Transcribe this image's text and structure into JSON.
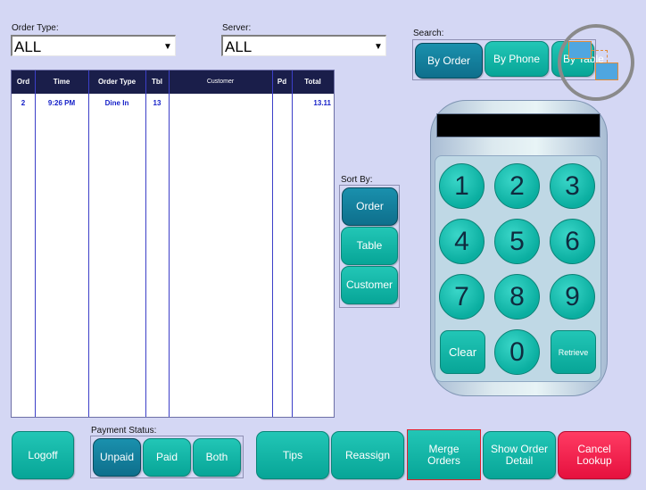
{
  "filters": {
    "order_type_label": "Order Type:",
    "order_type_value": "ALL",
    "server_label": "Server:",
    "server_value": "ALL"
  },
  "search": {
    "label": "Search:",
    "by_order": "By Order",
    "by_phone": "By Phone",
    "by_table": "By Table"
  },
  "table": {
    "columns": [
      "Ord",
      "Time",
      "Order Type",
      "Tbl",
      "Customer",
      "Pd",
      "Total"
    ],
    "rows": [
      {
        "ord": "2",
        "time": "9:26 PM",
        "order_type": "Dine In",
        "tbl": "13",
        "customer": "",
        "pd": "",
        "total": "13.11"
      }
    ]
  },
  "sort": {
    "label": "Sort By:",
    "order": "Order",
    "table": "Table",
    "customer": "Customer"
  },
  "keypad": {
    "keys": [
      "1",
      "2",
      "3",
      "4",
      "5",
      "6",
      "7",
      "8",
      "9"
    ],
    "clear": "Clear",
    "zero": "0",
    "retrieve": "Retrieve"
  },
  "bottom": {
    "logoff": "Logoff",
    "payment_status_label": "Payment Status:",
    "unpaid": "Unpaid",
    "paid": "Paid",
    "both": "Both",
    "tips": "Tips",
    "reassign": "Reassign",
    "merge_orders": "Merge Orders",
    "show_order_detail": "Show Order Detail",
    "cancel_lookup": "Cancel Lookup"
  },
  "colors": {
    "teal": "#0aae9f",
    "selected": "#12809d",
    "cancel": "#ee1f4d",
    "header_bg": "#1a1e4a",
    "row_text": "#1520c8"
  },
  "icons": {
    "combo_arrow": "chevron-down-icon",
    "cursor_overlay": "drag-cursor-icon"
  }
}
